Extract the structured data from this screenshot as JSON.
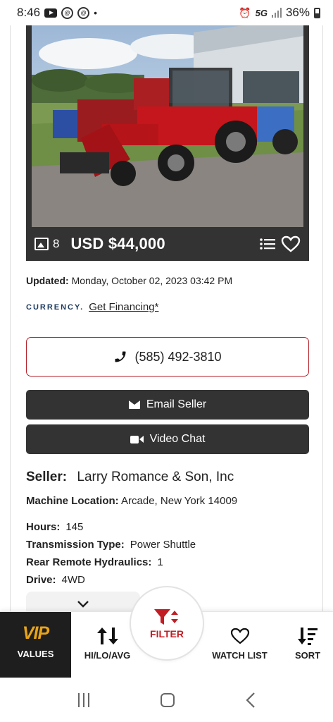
{
  "status_bar": {
    "time": "8:46",
    "dot": "•",
    "network": "5G",
    "battery": "36%"
  },
  "listing": {
    "photo_count": "8",
    "price": "USD $44,000",
    "updated_label": "Updated:",
    "updated_value": "Monday, October 02, 2023 03:42 PM",
    "currency_logo": "CURRENCY.",
    "financing_link": "Get Financing*",
    "phone": "(585) 492-3810",
    "email_button": "Email Seller",
    "video_button": "Video Chat",
    "seller_label": "Seller:",
    "seller_value": "Larry Romance & Son, Inc",
    "location_label": "Machine Location:",
    "location_value": "Arcade, New York 14009",
    "specs": [
      {
        "label": "Hours:",
        "value": "145"
      },
      {
        "label": "Transmission Type:",
        "value": "Power Shuttle"
      },
      {
        "label": "Rear Remote Hydraulics:",
        "value": "1"
      },
      {
        "label": "Drive:",
        "value": "4WD"
      }
    ]
  },
  "bottom_nav": {
    "vip_logo": "VIP",
    "values": "VALUES",
    "hilo": "HI/LO/AVG",
    "filter": "FILTER",
    "watch_list": "WATCH LIST",
    "sort": "SORT"
  },
  "colors": {
    "accent_red": "#c21d24",
    "dark": "#333333",
    "vip_gold": "#e8a418"
  }
}
